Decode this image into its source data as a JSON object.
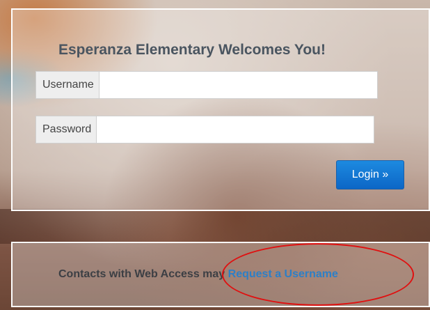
{
  "login": {
    "title": "Esperanza Elementary Welcomes You!",
    "username_label": "Username",
    "username_value": "",
    "password_label": "Password",
    "password_value": "",
    "login_button": "Login »"
  },
  "contacts": {
    "text": "Contacts with Web Access may ",
    "link": "Request a Username"
  },
  "colors": {
    "button": "#0c66c6",
    "link": "#2d7fc6",
    "annotation": "#e01010"
  }
}
